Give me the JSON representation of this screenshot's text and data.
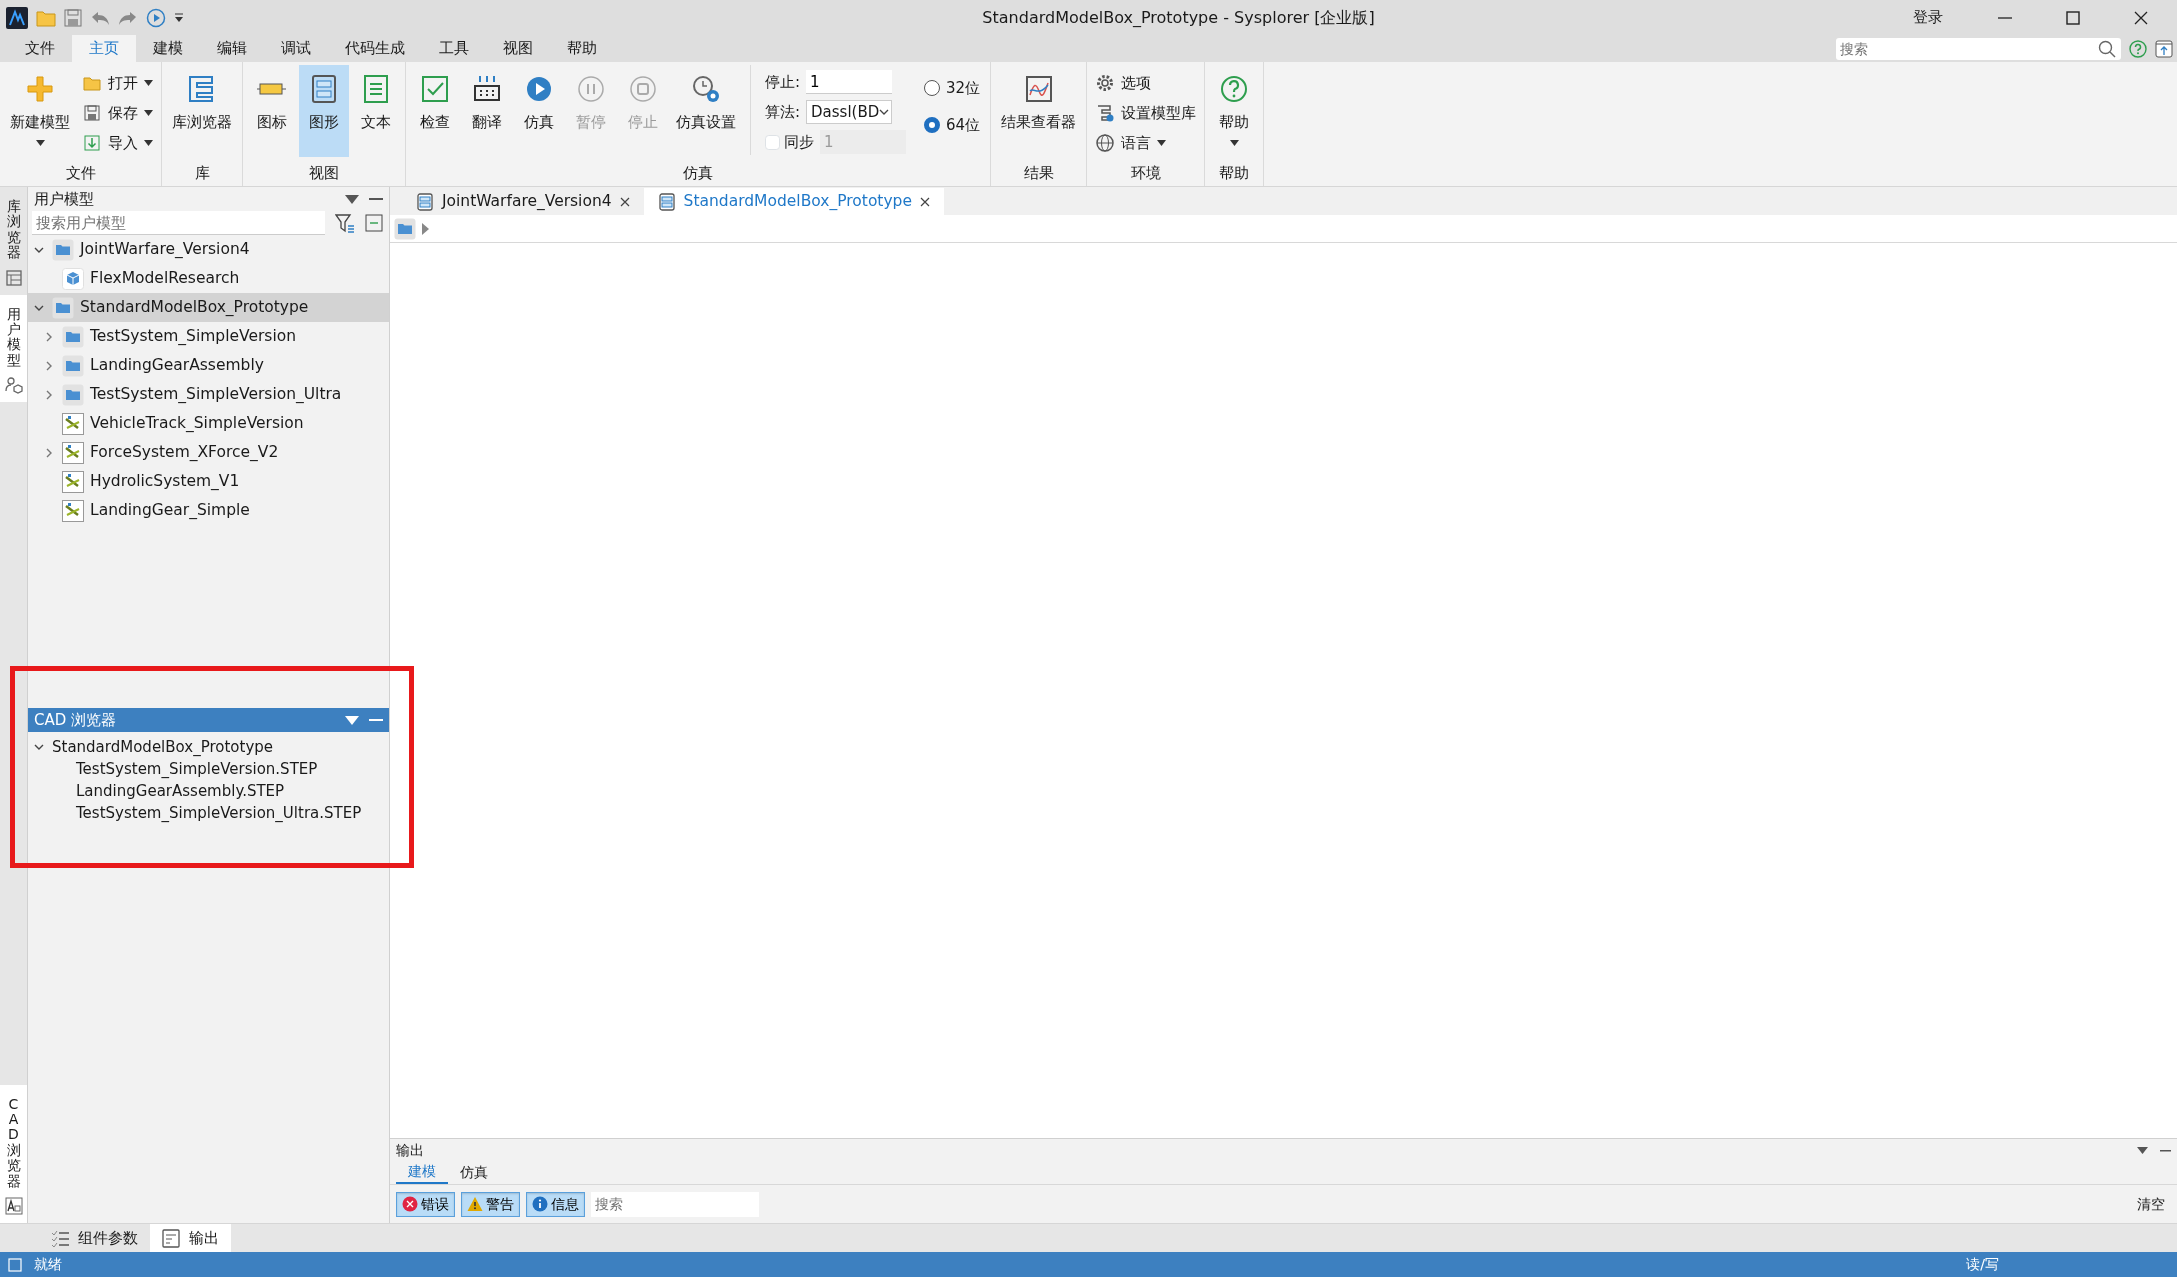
{
  "window": {
    "title": "StandardModelBox_Prototype - Sysplorer [企业版]",
    "login": "登录"
  },
  "menu": [
    {
      "label": "文件",
      "selected": false
    },
    {
      "label": "主页",
      "selected": true
    },
    {
      "label": "建模",
      "selected": false
    },
    {
      "label": "编辑",
      "selected": false
    },
    {
      "label": "调试",
      "selected": false
    },
    {
      "label": "代码生成",
      "selected": false
    },
    {
      "label": "工具",
      "selected": false
    },
    {
      "label": "视图",
      "selected": false
    },
    {
      "label": "帮助",
      "selected": false
    }
  ],
  "ribbon_search": {
    "placeholder": "搜索"
  },
  "ribbon": [
    {
      "label": "文件",
      "columns": [
        {
          "kind": "large",
          "label": "新建模型",
          "dropdown": true
        },
        {
          "kind": "stack",
          "items": [
            {
              "label": "打开",
              "dropdown": true
            },
            {
              "label": "保存",
              "dropdown": true
            },
            {
              "label": "导入",
              "dropdown": true
            }
          ]
        }
      ]
    },
    {
      "label": "库",
      "columns": [
        {
          "kind": "large",
          "label": "库浏览器",
          "dropdown": false
        }
      ]
    },
    {
      "label": "视图",
      "columns": [
        {
          "kind": "large",
          "label": "图标",
          "dropdown": false,
          "selected": false
        },
        {
          "kind": "large",
          "label": "图形",
          "dropdown": false,
          "selected": true
        },
        {
          "kind": "large",
          "label": "文本",
          "dropdown": false,
          "selected": false
        }
      ]
    },
    {
      "label": "仿真",
      "columns": [
        {
          "kind": "large",
          "label": "检查",
          "dropdown": false,
          "disabled": false
        },
        {
          "kind": "large",
          "label": "翻译",
          "dropdown": false,
          "disabled": false
        },
        {
          "kind": "large",
          "label": "仿真",
          "dropdown": false,
          "disabled": false
        },
        {
          "kind": "large",
          "label": "暂停",
          "dropdown": false,
          "disabled": true
        },
        {
          "kind": "large",
          "label": "停止",
          "dropdown": false,
          "disabled": true
        },
        {
          "kind": "large",
          "label": "仿真设置",
          "dropdown": false,
          "disabled": false
        },
        {
          "kind": "form",
          "rows": [
            {
              "kind": "input",
              "label": "停止:",
              "value": "1"
            },
            {
              "kind": "select",
              "label": "算法:",
              "value": "Dassl(BD"
            },
            {
              "kind": "check",
              "label": "同步",
              "checked": false,
              "value": "1",
              "disabled": true
            }
          ]
        },
        {
          "kind": "radios",
          "options": [
            {
              "label": "32位",
              "selected": false
            },
            {
              "label": "64位",
              "selected": true
            }
          ]
        }
      ]
    },
    {
      "label": "结果",
      "columns": [
        {
          "kind": "large",
          "label": "结果查看器",
          "dropdown": false
        }
      ]
    },
    {
      "label": "环境",
      "columns": [
        {
          "kind": "stack",
          "items": [
            {
              "label": "选项",
              "dropdown": false
            },
            {
              "label": "设置模型库",
              "dropdown": false
            },
            {
              "label": "语言",
              "dropdown": true
            }
          ]
        }
      ]
    },
    {
      "label": "帮助",
      "columns": [
        {
          "kind": "large",
          "label": "帮助",
          "dropdown": true
        }
      ]
    }
  ],
  "side_tabs": [
    {
      "label": "库浏览器",
      "selected": false
    },
    {
      "label": "用户模型",
      "selected": true
    },
    {
      "label": "CAD 浏览器",
      "selected": true
    }
  ],
  "user_models": {
    "title": "用户模型",
    "search": {
      "placeholder": "搜索用户模型"
    },
    "tree": [
      {
        "label": "JointWarfare_Version4",
        "kind": "folder",
        "expanded": true,
        "selected": false,
        "children": [
          {
            "label": "FlexModelResearch",
            "kind": "cube",
            "selected": false
          }
        ]
      },
      {
        "label": "StandardModelBox_Prototype",
        "kind": "folder",
        "expanded": true,
        "selected": true,
        "children": [
          {
            "label": "TestSystem_SimpleVersion",
            "kind": "folder",
            "expanded": false,
            "selected": false
          },
          {
            "label": "LandingGearAssembly",
            "kind": "folder",
            "expanded": false,
            "selected": false
          },
          {
            "label": "TestSystem_SimpleVersion_Ultra",
            "kind": "folder",
            "expanded": false,
            "selected": false
          },
          {
            "label": "VehicleTrack_SimpleVersion",
            "kind": "model",
            "selected": false
          },
          {
            "label": "ForceSystem_XForce_V2",
            "kind": "model",
            "expanded": false,
            "selected": false
          },
          {
            "label": "HydrolicSystem_V1",
            "kind": "model",
            "selected": false
          },
          {
            "label": "LandingGear_Simple",
            "kind": "model",
            "selected": false
          }
        ]
      }
    ]
  },
  "cad_browser": {
    "title": "CAD 浏览器",
    "tree": [
      {
        "label": "StandardModelBox_Prototype",
        "expanded": true,
        "children": [
          {
            "label": "TestSystem_SimpleVersion.STEP"
          },
          {
            "label": "LandingGearAssembly.STEP"
          },
          {
            "label": "TestSystem_SimpleVersion_Ultra.STEP"
          }
        ]
      }
    ]
  },
  "annotations": [
    {
      "kind": "frame"
    }
  ],
  "doc_tabs": [
    {
      "label": "JointWarfare_Version4",
      "selected": false
    },
    {
      "label": "StandardModelBox_Prototype",
      "selected": true
    }
  ],
  "output": {
    "title": "输出",
    "tabs": [
      {
        "label": "建模",
        "selected": true
      },
      {
        "label": "仿真",
        "selected": false
      }
    ],
    "filters": [
      {
        "kind": "error",
        "label": "错误",
        "selected": true
      },
      {
        "kind": "warning",
        "label": "警告",
        "selected": true
      },
      {
        "kind": "info",
        "label": "信息",
        "selected": true
      }
    ],
    "search": {
      "placeholder": "搜索"
    },
    "clear": "清空"
  },
  "bottom_tabs": [
    {
      "kind": "params",
      "label": "组件参数",
      "selected": false
    },
    {
      "kind": "output",
      "label": "输出",
      "selected": true
    }
  ],
  "status_bar": {
    "left": "就绪",
    "right": "读/写"
  }
}
